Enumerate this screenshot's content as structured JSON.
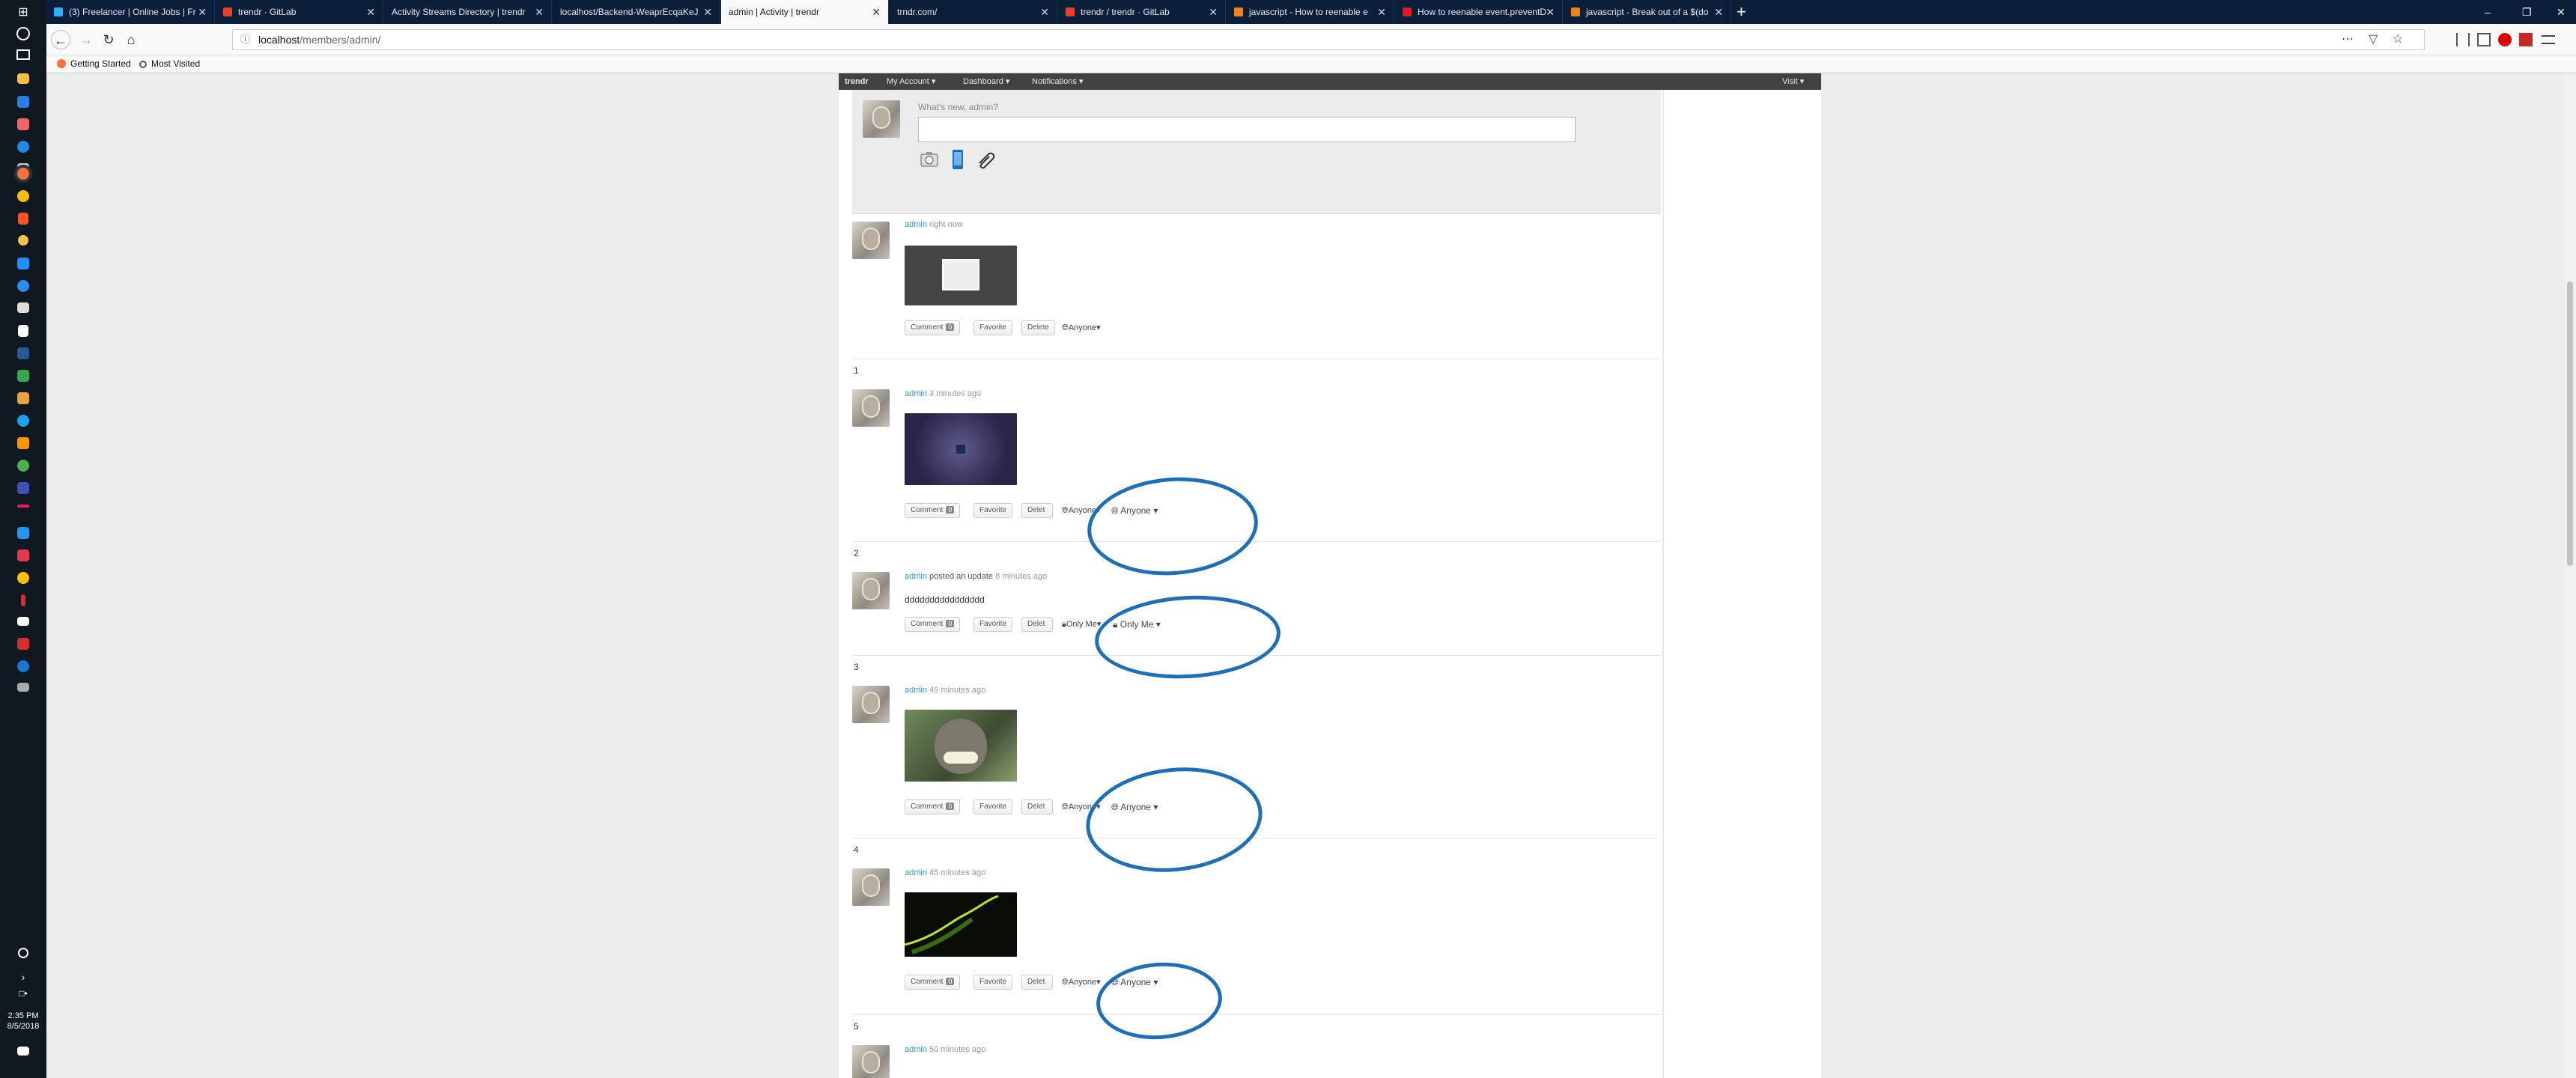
{
  "taskbar": {
    "time": "2:35 PM",
    "date": "8/5/2018"
  },
  "browser": {
    "tabs": [
      {
        "label": "(3) Freelancer | Online Jobs | Fr",
        "color": "#29b2fe"
      },
      {
        "label": "trendr · GitLab",
        "color": "#e24329"
      },
      {
        "label": "Activity Streams Directory | trendr",
        "color": "#888888"
      },
      {
        "label": "localhost/Backend-WeaprEcqaKeJ",
        "color": "#888888"
      },
      {
        "label": "admin | Activity | trendr",
        "color": "#888888"
      },
      {
        "label": "trndr.com/",
        "color": "#888888"
      },
      {
        "label": "trendr / trendr · GitLab",
        "color": "#e24329"
      },
      {
        "label": "javascript - How to reenable e",
        "color": "#f48024"
      },
      {
        "label": "How to reenable event.preventD",
        "color": "#e01b22"
      },
      {
        "label": "javascript - Break out of a $(do",
        "color": "#f48024"
      }
    ],
    "url_host": "localhost",
    "url_path": "/members/admin/",
    "bookmarks": [
      {
        "label": "Getting Started"
      },
      {
        "label": "Most Visited"
      }
    ]
  },
  "adminbar": {
    "site": "trendr",
    "my_account": "My Account",
    "dashboard": "Dashboard",
    "notifications": "Notifications",
    "visit": "Visit"
  },
  "whatsnew": {
    "label": "What's new, admin?"
  },
  "activity": {
    "user": "admin",
    "comment_label": "Comment",
    "comment_count": "0",
    "favorite_label": "Favorite",
    "delete_label": "Delete",
    "delete_partial": "Delet",
    "items": [
      {
        "number": "",
        "time": "right now",
        "privacy": "Anyone"
      },
      {
        "number": "1",
        "time": "3 minutes ago",
        "privacy": "Anyone",
        "privacy_dup": "Anyone"
      },
      {
        "number": "2",
        "action": "posted an update",
        "time": "8 minutes ago",
        "status": "dddddddddddddddd",
        "privacy": "Only Me",
        "privacy_dup": "Only Me"
      },
      {
        "number": "3",
        "time": "45 minutes ago",
        "privacy": "Anyone",
        "privacy_dup": "Anyone"
      },
      {
        "number": "4",
        "time": "45 minutes ago",
        "privacy": "Anyone",
        "privacy_dup": "Anyone"
      },
      {
        "number": "5",
        "time": "50 minutes ago"
      }
    ]
  },
  "colors": {
    "annotation_circle": "#1f6fb8",
    "link": "#2b9ad1",
    "adminbar": "#414141"
  }
}
